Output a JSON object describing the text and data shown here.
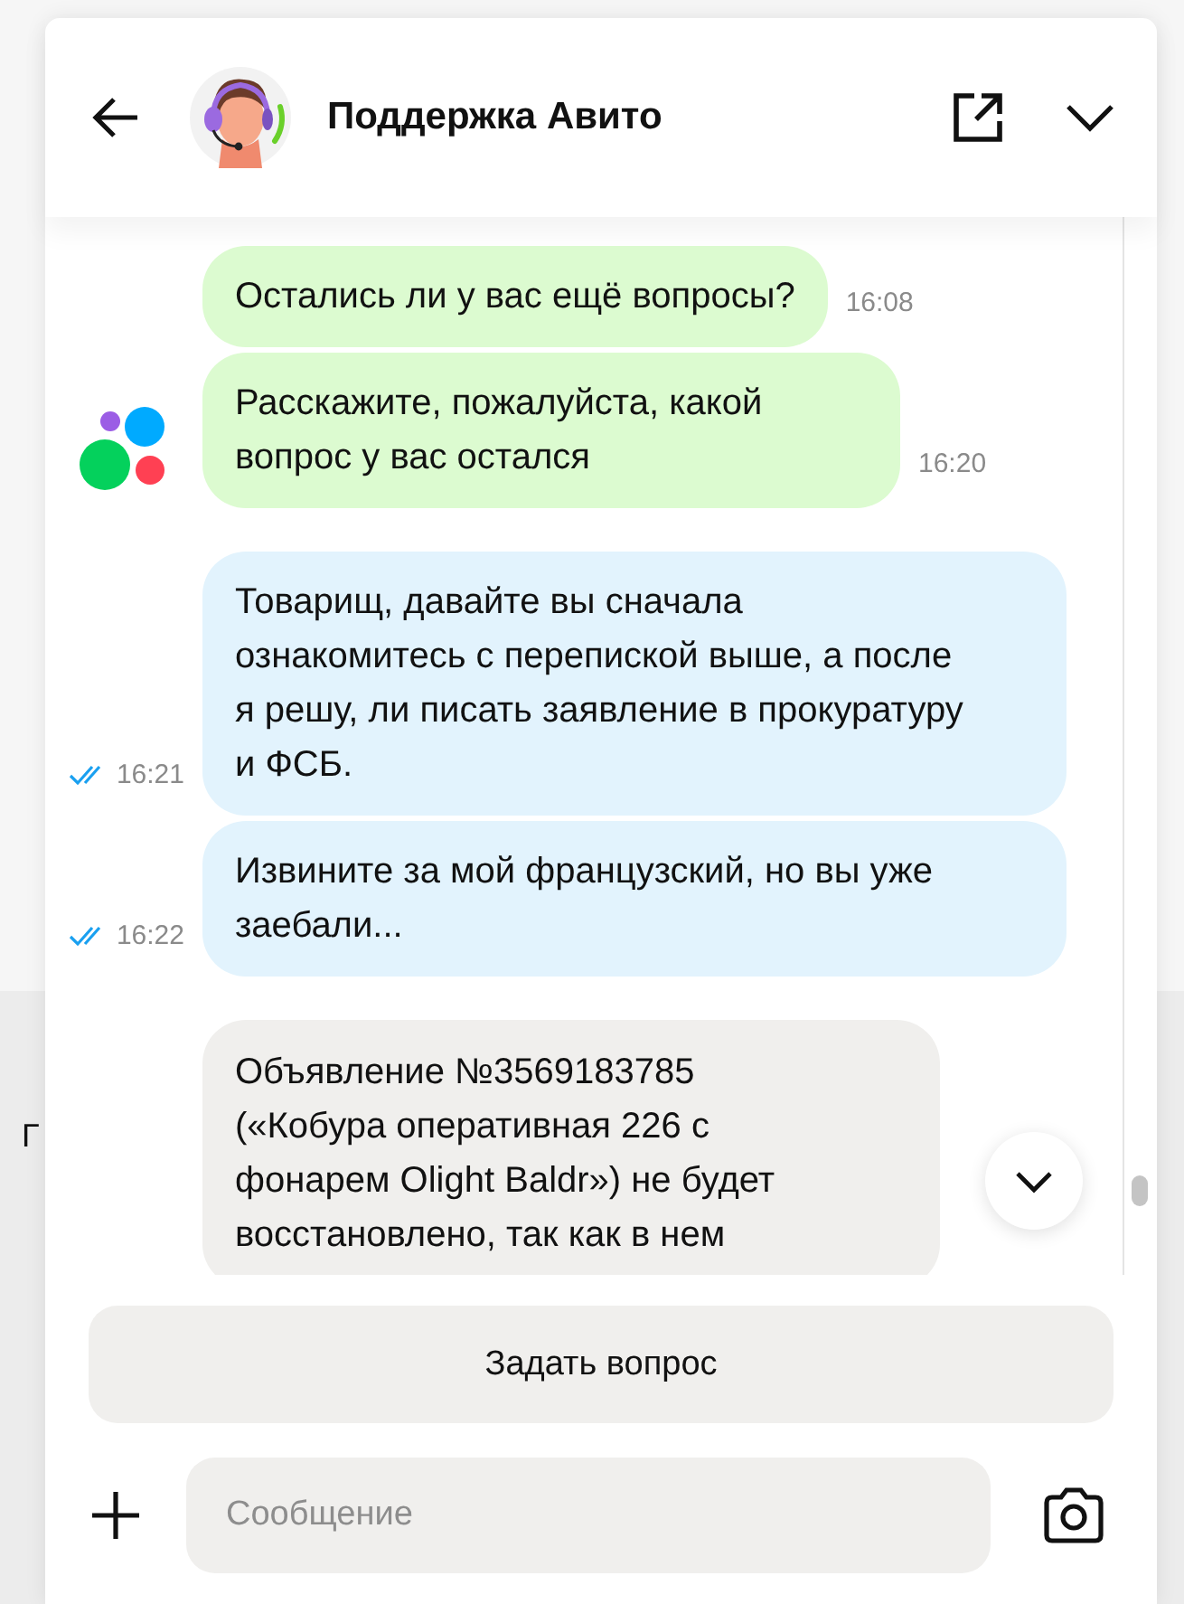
{
  "background": {
    "text": "Г"
  },
  "header": {
    "title": "Поддержка Авито"
  },
  "messages": [
    {
      "kind": "incoming",
      "text": "Остались ли у вас ещё вопросы?",
      "time": "16:08",
      "logo": false
    },
    {
      "kind": "incoming",
      "text": "Расскажите, пожалуйста, какой вопрос у вас остался",
      "time": "16:20",
      "logo": true
    },
    {
      "kind": "outgoing",
      "text": "Товарищ, давайте вы сначала ознакомитесь с перепиской выше, а после я решу, ли писать заявление в прокуратуру и ФСБ.",
      "time": "16:21",
      "read": true
    },
    {
      "kind": "outgoing",
      "text": "Извините за мой французский, но вы уже заебали...",
      "time": "16:22",
      "read": true
    },
    {
      "kind": "system",
      "text": "Объявление №3569183785 («Кобура оперативная 226 с фонарем Olight Baldr») не будет восстановлено, так как в нем"
    }
  ],
  "ask_button": "Задать вопрос",
  "composer": {
    "placeholder": "Сообщение"
  }
}
